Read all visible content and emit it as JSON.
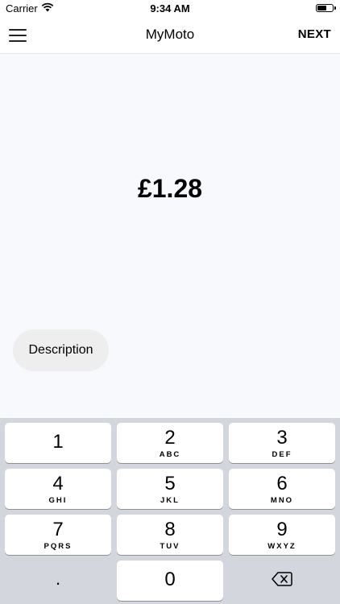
{
  "status": {
    "carrier": "Carrier",
    "time": "9:34 AM"
  },
  "nav": {
    "title": "MyMoto",
    "next_label": "NEXT"
  },
  "amount": {
    "display": "£1.28"
  },
  "description": {
    "label": "Description"
  },
  "keypad": {
    "k1": {
      "digit": "1",
      "letters": ""
    },
    "k2": {
      "digit": "2",
      "letters": "ABC"
    },
    "k3": {
      "digit": "3",
      "letters": "DEF"
    },
    "k4": {
      "digit": "4",
      "letters": "GHI"
    },
    "k5": {
      "digit": "5",
      "letters": "JKL"
    },
    "k6": {
      "digit": "6",
      "letters": "MNO"
    },
    "k7": {
      "digit": "7",
      "letters": "PQRS"
    },
    "k8": {
      "digit": "8",
      "letters": "TUV"
    },
    "k9": {
      "digit": "9",
      "letters": "WXYZ"
    },
    "dot": ".",
    "k0": {
      "digit": "0"
    }
  },
  "icons": {
    "menu": "hamburger-menu-icon",
    "wifi": "wifi-icon",
    "battery": "battery-icon",
    "backspace": "backspace-icon"
  }
}
